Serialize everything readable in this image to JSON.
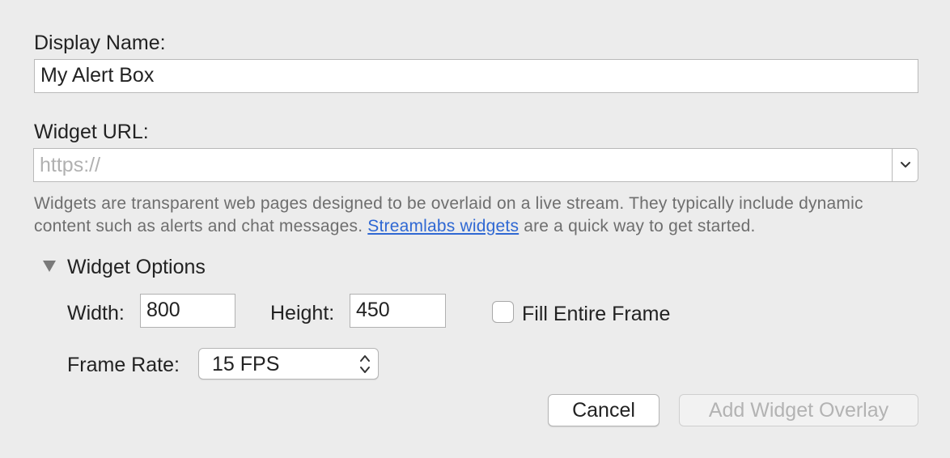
{
  "form": {
    "display_name": {
      "label": "Display Name:",
      "value": "My Alert Box"
    },
    "widget_url": {
      "label": "Widget URL:",
      "value": "",
      "placeholder": "https://",
      "dropdown_icon": "chevron-down-icon"
    },
    "description": {
      "before_link": "Widgets are transparent web pages designed to be overlaid on a live stream. They typically include dynamic content such as alerts and chat messages. ",
      "link_text": "Streamlabs widgets",
      "after_link": " are a quick way to get started."
    }
  },
  "widget_options": {
    "title": "Widget Options",
    "expanded": true,
    "disclosure_icon": "disclosure-triangle-down-icon",
    "width_label": "Width:",
    "width_value": "800",
    "height_label": "Height:",
    "height_value": "450",
    "fill_entire_frame_label": "Fill Entire Frame",
    "fill_entire_frame_checked": false,
    "frame_rate_label": "Frame Rate:",
    "frame_rate_value": "15 FPS",
    "frame_rate_icon": "up-down-chevrons-icon"
  },
  "buttons": {
    "cancel": "Cancel",
    "add_widget_overlay": "Add Widget Overlay",
    "add_widget_overlay_enabled": false
  },
  "colors": {
    "background": "#ececec",
    "link": "#2f68d3",
    "description_text": "#6e6e6e",
    "disabled_text": "#b3b3b3"
  }
}
